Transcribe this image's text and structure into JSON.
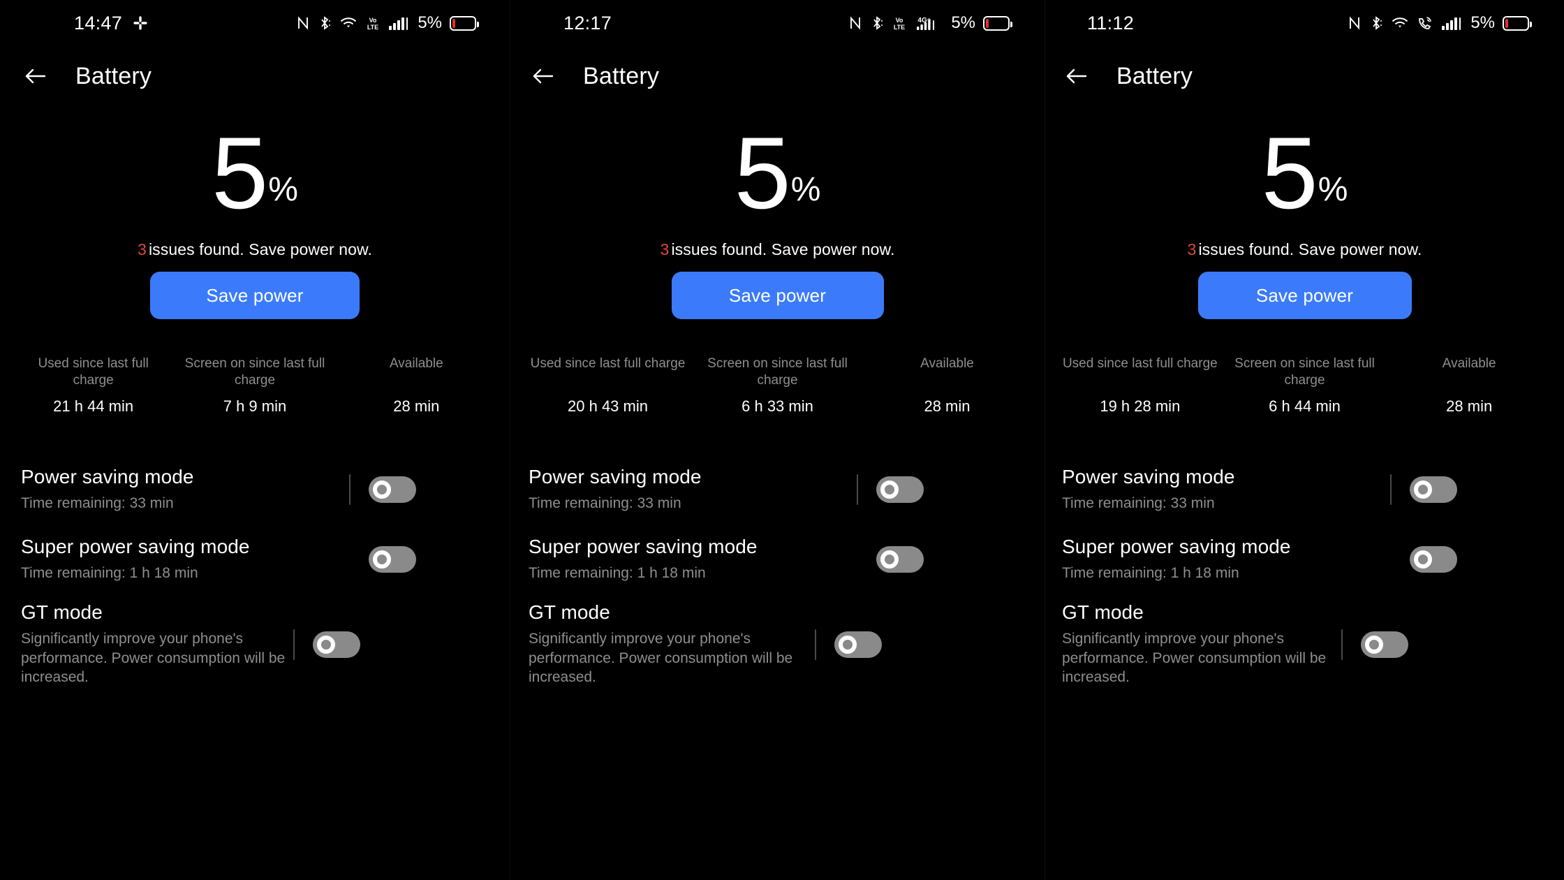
{
  "app": {
    "title": "Battery",
    "back_icon": "arrow-left-icon",
    "accent_blue": "#3b7bfb",
    "issue_red": "#e0483c"
  },
  "panels": [
    {
      "status": {
        "time": "14:47",
        "left_icons": [
          "slack-icon"
        ],
        "right_icons": [
          "nfc-icon",
          "bluetooth-icon",
          "wifi-icon",
          "volte-icon",
          "signal-bars-icon"
        ],
        "battery_percent": "5%"
      },
      "battery": {
        "level": "5",
        "percent_sign": "%"
      },
      "issues": {
        "count": "3",
        "message": "issues found. Save power now."
      },
      "save_button": "Save power",
      "stats": [
        {
          "label": "Used since last full charge",
          "value": "21 h 44 min"
        },
        {
          "label": "Screen on since last full charge",
          "value": "7 h 9 min"
        },
        {
          "label": "Available",
          "value": "28 min"
        }
      ],
      "settings": [
        {
          "title": "Power saving mode",
          "subtitle": "Time remaining:  33 min",
          "toggle": "off",
          "divider": true
        },
        {
          "title": "Super power saving mode",
          "subtitle": "Time remaining:  1 h 18 min",
          "toggle": "off",
          "divider": false
        },
        {
          "title": "GT mode",
          "subtitle": "Significantly improve your phone's performance. Power consumption will be increased.",
          "toggle": "off",
          "divider": true
        }
      ]
    },
    {
      "status": {
        "time": "12:17",
        "left_icons": [],
        "right_icons": [
          "nfc-icon",
          "bluetooth-icon",
          "volte-icon",
          "4g-plus-signal-icon"
        ],
        "battery_percent": "5%"
      },
      "battery": {
        "level": "5",
        "percent_sign": "%"
      },
      "issues": {
        "count": "3",
        "message": "issues found. Save power now."
      },
      "save_button": "Save power",
      "stats": [
        {
          "label": "Used since last full charge",
          "value": "20 h 43 min"
        },
        {
          "label": "Screen on since last full charge",
          "value": "6 h 33 min"
        },
        {
          "label": "Available",
          "value": "28 min"
        }
      ],
      "settings": [
        {
          "title": "Power saving mode",
          "subtitle": "Time remaining:  33 min",
          "toggle": "off",
          "divider": true
        },
        {
          "title": "Super power saving mode",
          "subtitle": "Time remaining:  1 h 18 min",
          "toggle": "off",
          "divider": false
        },
        {
          "title": "GT mode",
          "subtitle": "Significantly improve your phone's performance. Power consumption will be increased.",
          "toggle": "off",
          "divider": true
        }
      ]
    },
    {
      "status": {
        "time": "11:12",
        "left_icons": [],
        "right_icons": [
          "nfc-icon",
          "bluetooth-icon",
          "wifi-icon",
          "wifi-calling-icon",
          "signal-bars-icon"
        ],
        "battery_percent": "5%"
      },
      "battery": {
        "level": "5",
        "percent_sign": "%"
      },
      "issues": {
        "count": "3",
        "message": "issues found. Save power now."
      },
      "save_button": "Save power",
      "stats": [
        {
          "label": "Used since last full charge",
          "value": "19 h 28 min"
        },
        {
          "label": "Screen on since last full charge",
          "value": "6 h 44 min"
        },
        {
          "label": "Available",
          "value": "28 min"
        }
      ],
      "settings": [
        {
          "title": "Power saving mode",
          "subtitle": "Time remaining:  33 min",
          "toggle": "off",
          "divider": true
        },
        {
          "title": "Super power saving mode",
          "subtitle": "Time remaining:  1 h 18 min",
          "toggle": "off",
          "divider": false
        },
        {
          "title": "GT mode",
          "subtitle": "Significantly improve your phone's performance. Power consumption will be increased.",
          "toggle": "off",
          "divider": true
        }
      ]
    }
  ]
}
